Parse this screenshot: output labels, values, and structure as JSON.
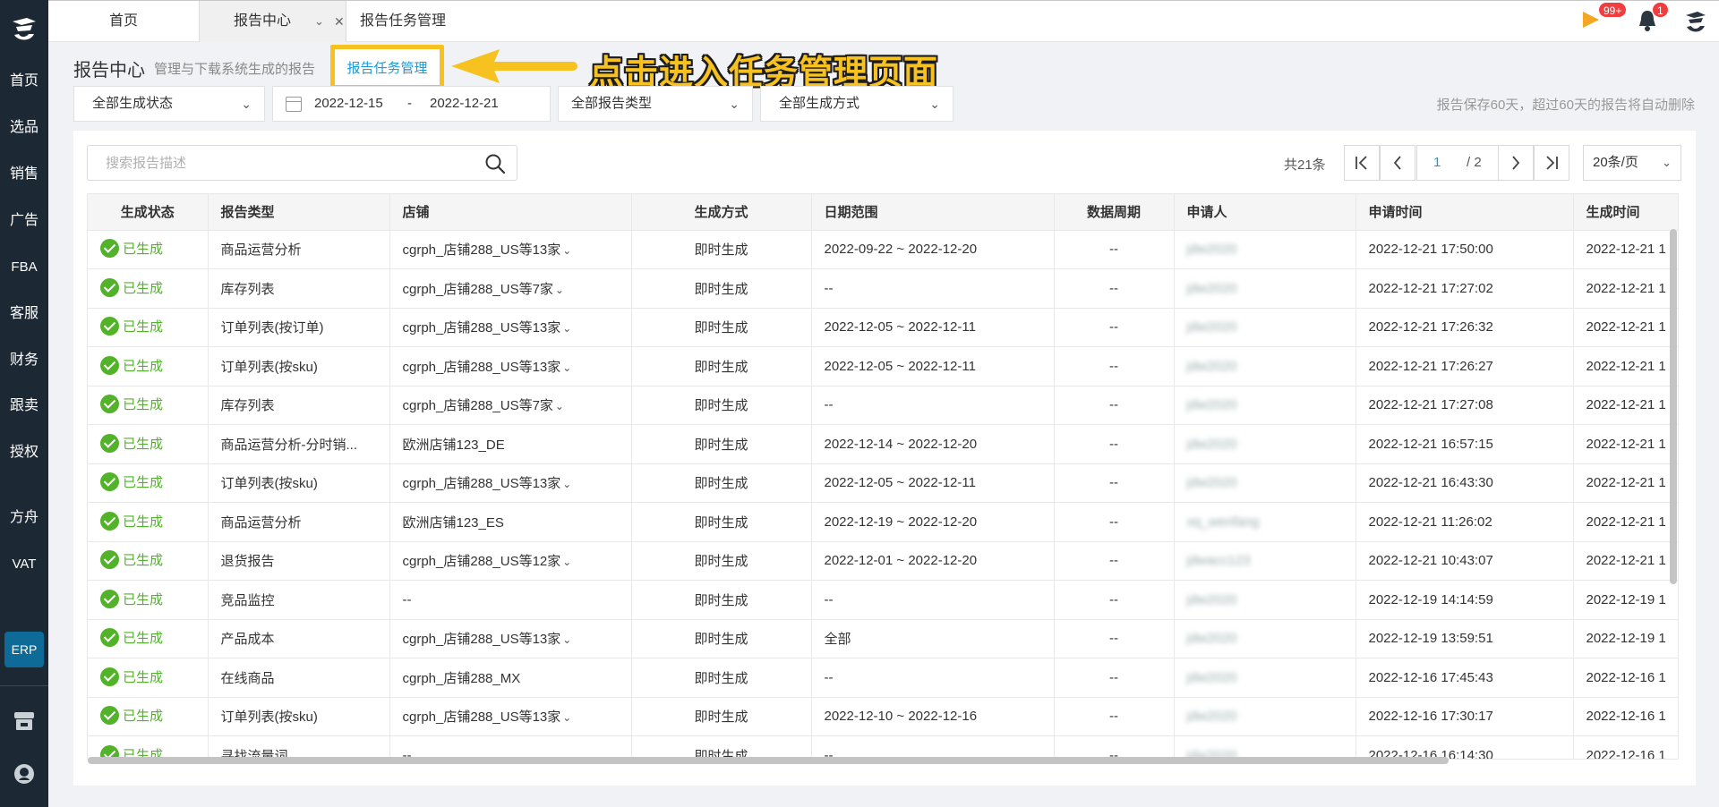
{
  "sidebar": {
    "logo": "brand-logo",
    "items": [
      {
        "label": "首页"
      },
      {
        "label": "选品"
      },
      {
        "label": "销售"
      },
      {
        "label": "广告"
      },
      {
        "label": "FBA"
      },
      {
        "label": "客服"
      },
      {
        "label": "财务"
      },
      {
        "label": "跟卖"
      },
      {
        "label": "授权"
      },
      {
        "label": "方舟"
      },
      {
        "label": "VAT"
      }
    ],
    "erp_label": "ERP"
  },
  "tabs": [
    {
      "label": "首页"
    },
    {
      "label": "报告中心"
    },
    {
      "label": "报告任务管理"
    }
  ],
  "header_right": {
    "flag_badge": "99+",
    "bell_badge": "1"
  },
  "title": {
    "main": "报告中心",
    "subtitle": "管理与下载系统生成的报告",
    "task_link": "报告任务管理",
    "annotation": "点击进入任务管理页面"
  },
  "filters": {
    "status": "全部生成状态",
    "date_start": "2022-12-15",
    "date_sep": "-",
    "date_end": "2022-12-21",
    "report_type": "全部报告类型",
    "gen_method": "全部生成方式",
    "retention_note": "报告保存60天，超过60天的报告将自动删除"
  },
  "search": {
    "placeholder": "搜索报告描述"
  },
  "pagination": {
    "total": "共21条",
    "current": "1",
    "total_pages": "/ 2",
    "page_size": "20条/页"
  },
  "table": {
    "headers": [
      "生成状态",
      "报告类型",
      "店铺",
      "生成方式",
      "日期范围",
      "数据周期",
      "申请人",
      "申请时间",
      "生成时间"
    ],
    "rows": [
      {
        "status": "已生成",
        "type": "商品运营分析",
        "store": "cgrph_店铺288_US等13家",
        "method": "即时生成",
        "range": "2022-09-22 ~ 2022-12-20",
        "period": "--",
        "applicant": "jdw2020",
        "apply_time": "2022-12-21 17:50:00",
        "gen_time": "2022-12-21 1"
      },
      {
        "status": "已生成",
        "type": "库存列表",
        "store": "cgrph_店铺288_US等7家",
        "method": "即时生成",
        "range": "--",
        "period": "--",
        "applicant": "jdw2020",
        "apply_time": "2022-12-21 17:27:02",
        "gen_time": "2022-12-21 1"
      },
      {
        "status": "已生成",
        "type": "订单列表(按订单)",
        "store": "cgrph_店铺288_US等13家",
        "method": "即时生成",
        "range": "2022-12-05 ~ 2022-12-11",
        "period": "--",
        "applicant": "jdw2020",
        "apply_time": "2022-12-21 17:26:32",
        "gen_time": "2022-12-21 1"
      },
      {
        "status": "已生成",
        "type": "订单列表(按sku)",
        "store": "cgrph_店铺288_US等13家",
        "method": "即时生成",
        "range": "2022-12-05 ~ 2022-12-11",
        "period": "--",
        "applicant": "jdw2020",
        "apply_time": "2022-12-21 17:26:27",
        "gen_time": "2022-12-21 1"
      },
      {
        "status": "已生成",
        "type": "库存列表",
        "store": "cgrph_店铺288_US等7家",
        "method": "即时生成",
        "range": "--",
        "period": "--",
        "applicant": "jdw2020",
        "apply_time": "2022-12-21 17:27:08",
        "gen_time": "2022-12-21 1"
      },
      {
        "status": "已生成",
        "type": "商品运营分析-分时销...",
        "store": "欧洲店铺123_DE",
        "method": "即时生成",
        "range": "2022-12-14 ~ 2022-12-20",
        "period": "--",
        "applicant": "jdw2020",
        "apply_time": "2022-12-21 16:57:15",
        "gen_time": "2022-12-21 1"
      },
      {
        "status": "已生成",
        "type": "订单列表(按sku)",
        "store": "cgrph_店铺288_US等13家",
        "method": "即时生成",
        "range": "2022-12-05 ~ 2022-12-11",
        "period": "--",
        "applicant": "jdw2020",
        "apply_time": "2022-12-21 16:43:30",
        "gen_time": "2022-12-21 1"
      },
      {
        "status": "已生成",
        "type": "商品运营分析",
        "store": "欧洲店铺123_ES",
        "method": "即时生成",
        "range": "2022-12-19 ~ 2022-12-20",
        "period": "--",
        "applicant": "xq_wenfang",
        "apply_time": "2022-12-21 11:26:02",
        "gen_time": "2022-12-21 1"
      },
      {
        "status": "已生成",
        "type": "退货报告",
        "store": "cgrph_店铺288_US等12家",
        "method": "即时生成",
        "range": "2022-12-01 ~ 2022-12-20",
        "period": "--",
        "applicant": "jdwacc123",
        "apply_time": "2022-12-21 10:43:07",
        "gen_time": "2022-12-21 1"
      },
      {
        "status": "已生成",
        "type": "竞品监控",
        "store": "--",
        "method": "即时生成",
        "range": "--",
        "period": "--",
        "applicant": "jdw2020",
        "apply_time": "2022-12-19 14:14:59",
        "gen_time": "2022-12-19 1"
      },
      {
        "status": "已生成",
        "type": "产品成本",
        "store": "cgrph_店铺288_US等13家",
        "method": "即时生成",
        "range": "全部",
        "period": "--",
        "applicant": "jdw2020",
        "apply_time": "2022-12-19 13:59:51",
        "gen_time": "2022-12-19 1"
      },
      {
        "status": "已生成",
        "type": "在线商品",
        "store": "cgrph_店铺288_MX",
        "method": "即时生成",
        "range": "--",
        "period": "--",
        "applicant": "jdw2020",
        "apply_time": "2022-12-16 17:45:43",
        "gen_time": "2022-12-16 1"
      },
      {
        "status": "已生成",
        "type": "订单列表(按sku)",
        "store": "cgrph_店铺288_US等13家",
        "method": "即时生成",
        "range": "2022-12-10 ~ 2022-12-16",
        "period": "--",
        "applicant": "jdw2020",
        "apply_time": "2022-12-16 17:30:17",
        "gen_time": "2022-12-16 1"
      },
      {
        "status": "已生成",
        "type": "寻找流量词",
        "store": "--",
        "method": "即时生成",
        "range": "--",
        "period": "--",
        "applicant": "jdw2020",
        "apply_time": "2022-12-16 16:14:30",
        "gen_time": "2022-12-16 1"
      }
    ]
  },
  "colors": {
    "sidebar_bg": "#1c2935",
    "accent_blue": "#1a9bd7",
    "success_green": "#52b22a",
    "annotation_yellow": "#f7c21f",
    "badge_red": "#f03d3d"
  }
}
